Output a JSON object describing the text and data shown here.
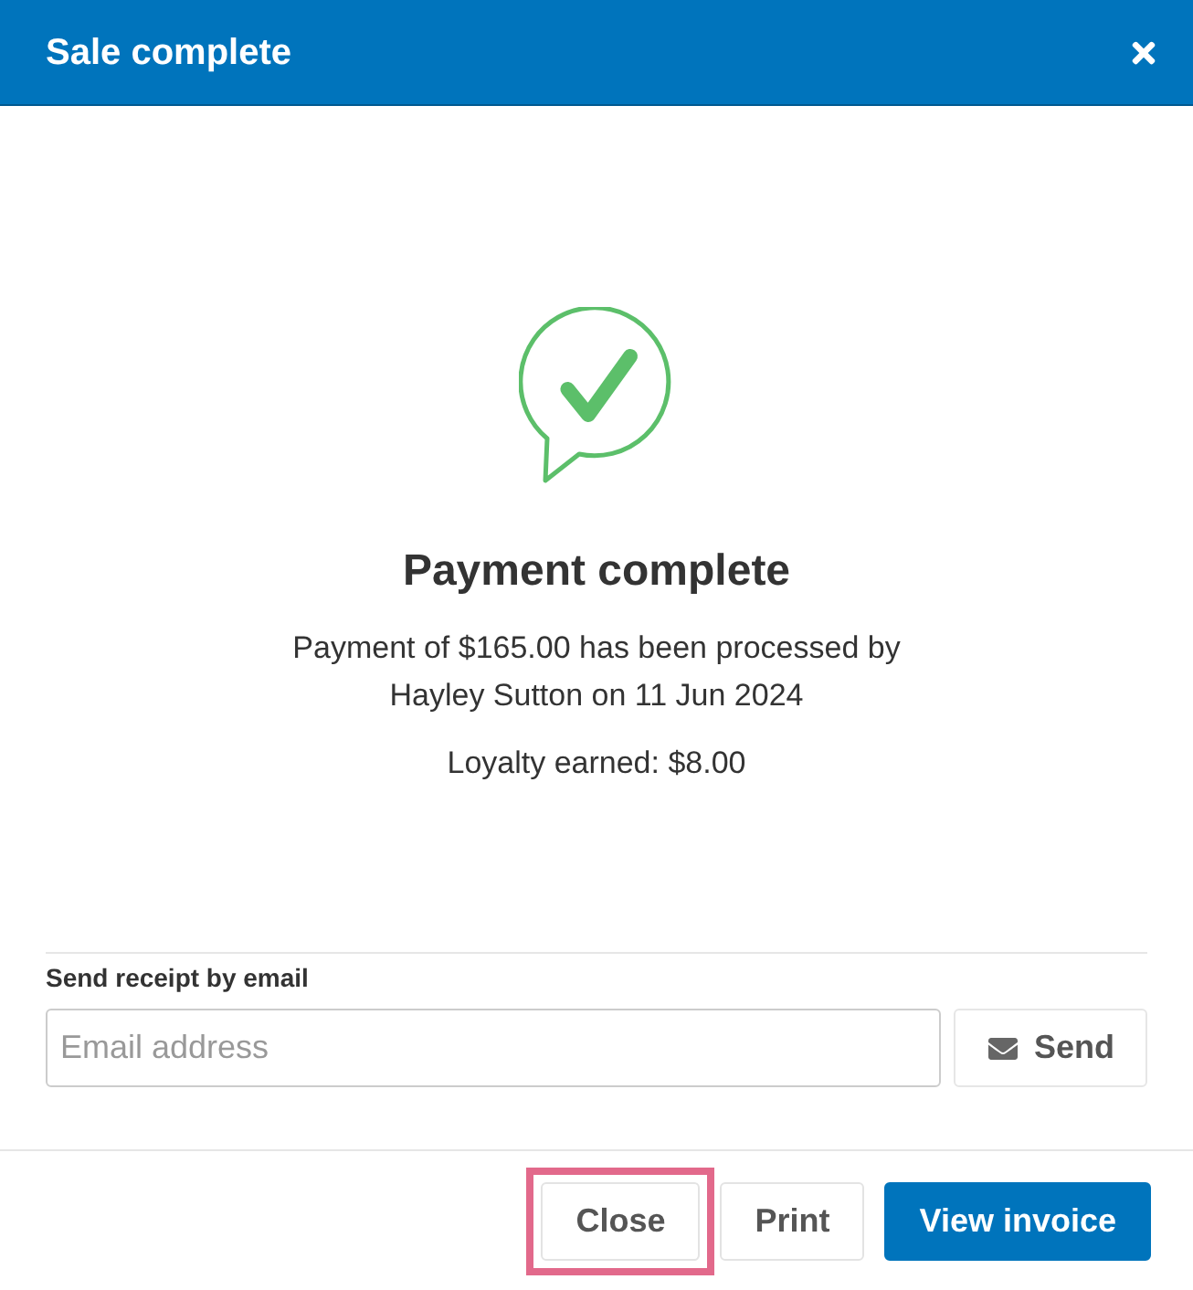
{
  "dialog": {
    "title": "Sale complete"
  },
  "result": {
    "kind": "success",
    "heading": "Payment complete",
    "message": "Payment of $165.00 has been processed by Hayley Sutton on 11 Jun 2024",
    "loyalty": "Loyalty earned: $8.00"
  },
  "email_receipt": {
    "label": "Send receipt by email",
    "placeholder": "Email address",
    "button": "Send"
  },
  "buttons": [
    {
      "label": "Close",
      "kind": "default",
      "highlighted": true
    },
    {
      "label": "Print",
      "kind": "default",
      "highlighted": false
    },
    {
      "label": "View invoice",
      "kind": "primary",
      "highlighted": false
    }
  ]
}
